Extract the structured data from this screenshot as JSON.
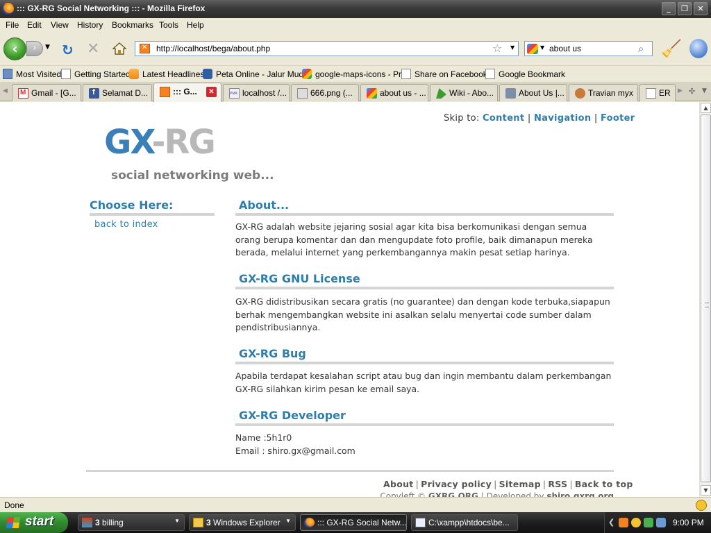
{
  "window": {
    "title": "::: GX-RG Social Networking ::: - Mozilla Firefox",
    "minimize": "_",
    "maximize": "❐",
    "close": "✕"
  },
  "menu": [
    "File",
    "Edit",
    "View",
    "History",
    "Bookmarks",
    "Tools",
    "Help"
  ],
  "navbar": {
    "url": "http://localhost/bega/about.php",
    "search_query": "about us"
  },
  "bookmarks": [
    "Most Visited",
    "Getting Started",
    "Latest Headlines",
    "Peta Online - Jalur Mud...",
    "google-maps-icons - Pr...",
    "Share on Facebook",
    "Google Bookmark"
  ],
  "tabs": [
    {
      "label": "Gmail - [G..."
    },
    {
      "label": "Selamat D..."
    },
    {
      "label": "::: G..."
    },
    {
      "label": "localhost /..."
    },
    {
      "label": "666.png (..."
    },
    {
      "label": "about us - ..."
    },
    {
      "label": "Wiki - Abo..."
    },
    {
      "label": "About Us |..."
    },
    {
      "label": "Travian myx"
    },
    {
      "label": "ER"
    }
  ],
  "page": {
    "skip_label": "Skip to:",
    "skip_links": [
      "Content",
      "Navigation",
      "Footer"
    ],
    "logo_gx": "GX",
    "logo_rg": "-RG",
    "tagline": "social networking web...",
    "sidebar": {
      "heading": "Choose Here:",
      "link": "back to index"
    },
    "sections": [
      {
        "heading": "About...",
        "body": "GX-RG adalah website jejaring sosial agar kita bisa berkomunikasi dengan semua orang berupa komentar dan dan mengupdate foto profile, baik dimanapun mereka berada, melalui internet yang perkembangannya makin pesat setiap harinya."
      },
      {
        "heading": "GX-RG GNU License",
        "body": "GX-RG didistribusikan secara gratis (no guarantee) dan dengan kode terbuka,siapapun berhak mengembangkan website ini asalkan selalu menyertai code sumber dalam pendistribusiannya."
      },
      {
        "heading": "GX-RG Bug",
        "body": "Apabila terdapat kesalahan script atau bug dan ingin membantu dalam perkembangan GX-RG silahkan kirim pesan ke email saya."
      },
      {
        "heading": "GX-RG Developer",
        "name_line": "Name :5h1r0",
        "email_line": "Email : shiro.gx@gmail.com"
      }
    ],
    "footer_links": [
      "About",
      "Privacy policy",
      "Sitemap",
      "RSS",
      "Back to top"
    ],
    "footer_copy_prefix": "Copyleft © ",
    "footer_copy_org": "GXRG.ORG",
    "footer_copy_mid": " | Developed by ",
    "footer_copy_dev": "shiro.gxrg.org"
  },
  "status": "Done",
  "taskbar": {
    "start": "start",
    "tasks": [
      {
        "count": "3",
        "label": " billing"
      },
      {
        "count": "3",
        "label": " Windows Explorer"
      },
      {
        "label": "::: GX-RG Social Netw..."
      },
      {
        "label": "C:\\xampp\\htdocs\\be..."
      }
    ],
    "clock": "9:00 PM"
  }
}
